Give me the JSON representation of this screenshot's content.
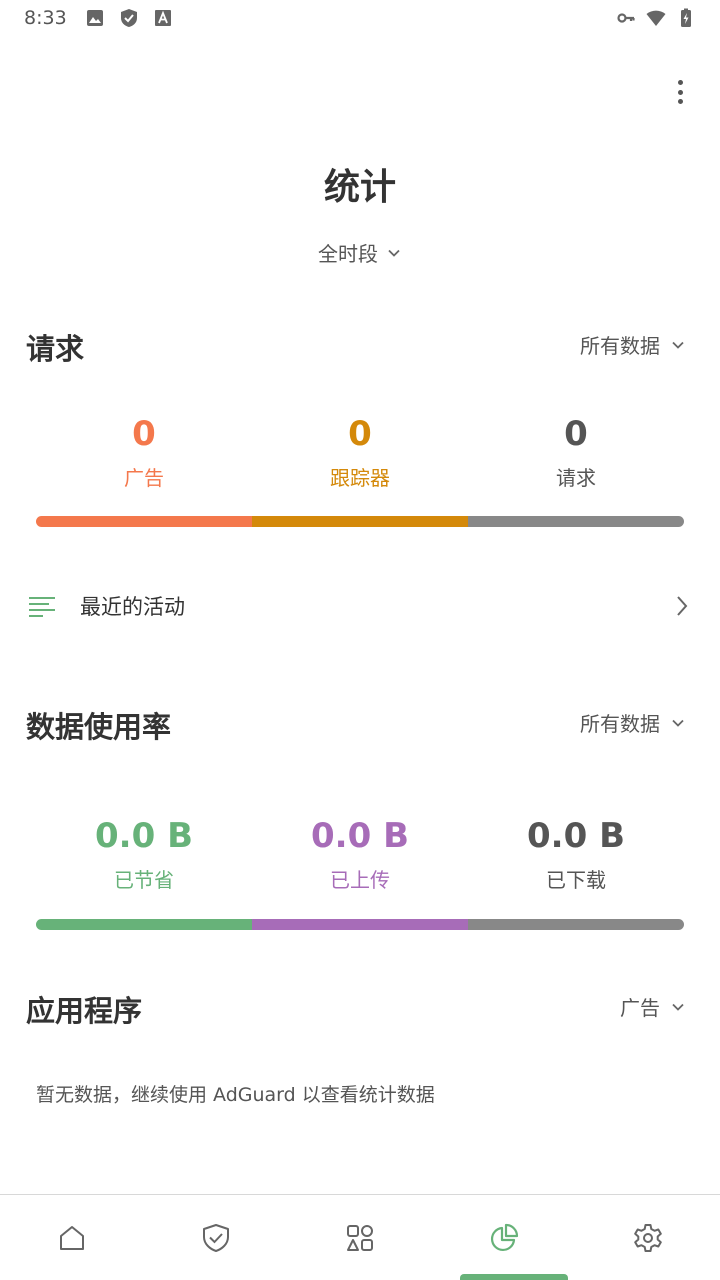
{
  "status_bar": {
    "time": "8:33"
  },
  "header": {
    "title": "统计",
    "period": "全时段"
  },
  "requests": {
    "title": "请求",
    "filter": "所有数据",
    "stats": [
      {
        "value": "0",
        "label": "广告",
        "color": "#f4784c"
      },
      {
        "value": "0",
        "label": "跟踪器",
        "color": "#d4890a"
      },
      {
        "value": "0",
        "label": "请求",
        "color": "#555555"
      }
    ],
    "bar_colors": [
      "#f4784c",
      "#d4890a",
      "#888888"
    ]
  },
  "recent_activity": {
    "label": "最近的活动",
    "icon": "list-icon"
  },
  "data_usage": {
    "title": "数据使用率",
    "filter": "所有数据",
    "stats": [
      {
        "value": "0.0 B",
        "label": "已节省",
        "color": "#67b279"
      },
      {
        "value": "0.0 B",
        "label": "已上传",
        "color": "#a76cb8"
      },
      {
        "value": "0.0 B",
        "label": "已下载",
        "color": "#555555"
      }
    ],
    "bar_colors": [
      "#67b279",
      "#a76cb8",
      "#888888"
    ]
  },
  "apps": {
    "title": "应用程序",
    "filter": "广告",
    "empty_message": "暂无数据，继续使用 AdGuard 以查看统计数据"
  },
  "bottom_nav": {
    "items": [
      {
        "name": "home-icon",
        "active": false
      },
      {
        "name": "shield-check-icon",
        "active": false
      },
      {
        "name": "apps-icon",
        "active": false
      },
      {
        "name": "pie-chart-icon",
        "active": true
      },
      {
        "name": "gear-icon",
        "active": false
      }
    ],
    "accent": "#67b279"
  }
}
